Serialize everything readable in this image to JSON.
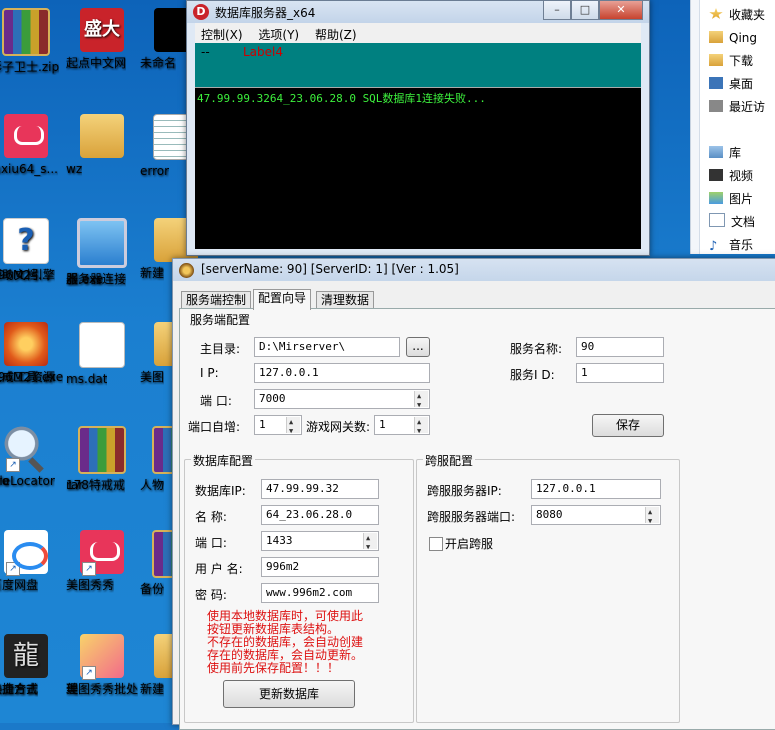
{
  "desktop": {
    "icons": [
      {
        "label": "彩子卫士.zip"
      },
      {
        "label": "起点中文网"
      },
      {
        "label": "未命名"
      },
      {
        "label": "iuxiu64_s..."
      },
      {
        "label": "wz"
      },
      {
        "label": "error"
      },
      {
        "label_line1": "996M2引擎",
        "label_line2": "帮助文档..."
      },
      {
        "label_line1": "服务器连接",
        "label_line2": "器.exe"
      },
      {
        "label": "新建"
      },
      {
        "label_line1": "996M2资源",
        "label_line2": "生成工具.exe"
      },
      {
        "label": "ms.dat"
      },
      {
        "label": "美图"
      },
      {
        "label_line1": "FileLocator",
        "label_line2": "Pro"
      },
      {
        "label_line1": "178特戒戒",
        "label_line2": "rar"
      },
      {
        "label": "人物"
      },
      {
        "label": "百度网盘"
      },
      {
        "label": "美图秀秀"
      },
      {
        "label": "备份"
      },
      {
        "label_line1": "热血合击",
        "label_line2": "快捷方式"
      },
      {
        "label_line1": "美图秀秀批处",
        "label_line2": "理"
      },
      {
        "label": "新建"
      }
    ],
    "red_icon_text": "盛大",
    "game_icon_text": "龍"
  },
  "explorer": {
    "items": [
      {
        "label": "收藏夹",
        "icon": "favorites-star-icon"
      },
      {
        "label": "Qing",
        "icon": "folder-icon"
      },
      {
        "label": "下载",
        "icon": "folder-icon"
      },
      {
        "label": "桌面",
        "icon": "desktop-icon"
      },
      {
        "label": "最近访",
        "icon": "recent-icon"
      },
      {
        "label": "库",
        "icon": "library-icon"
      },
      {
        "label": "视频",
        "icon": "video-icon"
      },
      {
        "label": "图片",
        "icon": "picture-icon"
      },
      {
        "label": "文档",
        "icon": "document-icon"
      },
      {
        "label": "音乐",
        "icon": "music-icon"
      }
    ]
  },
  "db_window": {
    "title": "数据库服务器_x64",
    "icon_letter": "D",
    "menu": [
      "控制(X)",
      "选项(Y)",
      "帮助(Z)"
    ],
    "status_dash": "--",
    "status_label": "Label4",
    "console_line": "47.99.99.3264_23.06.28.0 SQL数据库1连接失败..."
  },
  "cfg_window": {
    "title": "[serverName: 90] [ServerID: 1] [Ver : 1.05]",
    "tabs": [
      "服务端控制",
      "配置向导",
      "清理数据"
    ],
    "server_section": {
      "title": "服务端配置",
      "main_dir_label": "主目录:",
      "main_dir_value": "D:\\Mirserver\\",
      "browse_label": "...",
      "ip_label": "I     P:",
      "ip_value": "127.0.0.1",
      "port_label": "端    口:",
      "port_value": "7000",
      "port_inc_label": "端口自增:",
      "port_inc_value": "1",
      "gate_label": "游戏网关数:",
      "gate_value": "1",
      "name_label": "服务名称:",
      "name_value": "90",
      "id_label": "服务I   D:",
      "id_value": "1",
      "save_label": "保存"
    },
    "db_section": {
      "title": "数据库配置",
      "ip_label": "数据库IP:",
      "ip_value": "47.99.99.32",
      "name_label": "名     称:",
      "name_value": "64_23.06.28.0",
      "port_label": "端     口:",
      "port_value": "1433",
      "user_label": "用 户 名:",
      "user_value": "996m2",
      "pwd_label": "密     码:",
      "pwd_value": "www.996m2.com",
      "notice": [
        "使用本地数据库时，可使用此",
        "按钮更新数据库表结构。",
        "不存在的数据库，会自动创建",
        "存在的数据库，会自动更新。",
        "使用前先保存配置！！！"
      ],
      "update_label": "更新数据库"
    },
    "cross_section": {
      "title": "跨服配置",
      "ip_label": "跨服服务器IP:",
      "ip_value": "127.0.0.1",
      "port_label": "跨服服务器端口:",
      "port_value": "8080",
      "enable_label": "开启跨服",
      "enable_checked": false
    }
  }
}
